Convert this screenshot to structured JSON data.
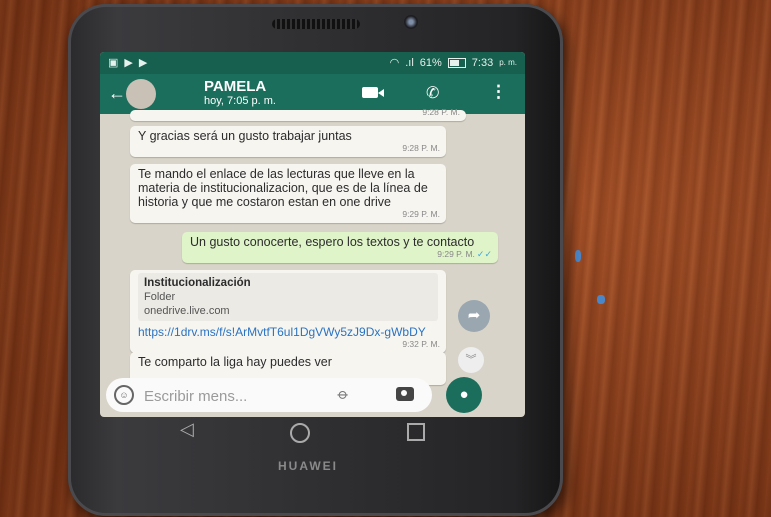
{
  "status_bar": {
    "signal": ".ıl",
    "battery": "61%",
    "time": "7:33",
    "ampm": "p. m."
  },
  "chat_header": {
    "contact_name": "PAMELA",
    "last_seen": "hoy, 7:05 p. m.",
    "icons": [
      "back-arrow-icon",
      "avatar",
      "video-call-icon",
      "phone-icon",
      "menu-icon"
    ]
  },
  "messages": [
    {
      "direction": "in",
      "text": "",
      "time": "9:28 P. M."
    },
    {
      "direction": "in",
      "text": "Y gracias será un gusto trabajar juntas",
      "time": "9:28 P. M."
    },
    {
      "direction": "in",
      "text": "Te mando el enlace de las lecturas que lleve en la materia de institucionalizacion, que es de la línea de historia y que me costaron estan en one drive",
      "time": "9:29 P. M."
    },
    {
      "direction": "out",
      "text": "Un gusto conocerte, espero los textos y te contacto",
      "time": "9:29 P. M.",
      "ticks": "✓✓"
    },
    {
      "direction": "in",
      "link_title": "Institucionalización",
      "link_type": "Folder",
      "link_domain": "onedrive.live.com",
      "url": "https://1drv.ms/f/s!ArMvtfT6ul1DgVWy5zJ9Dx-gWbDY",
      "time": "9:32 P. M."
    },
    {
      "direction": "in",
      "text": "Te comparto la liga hay puedes ver",
      "time": ""
    }
  ],
  "input": {
    "placeholder": "Escribir mens..."
  },
  "device": {
    "brand": "HUAWEI"
  }
}
